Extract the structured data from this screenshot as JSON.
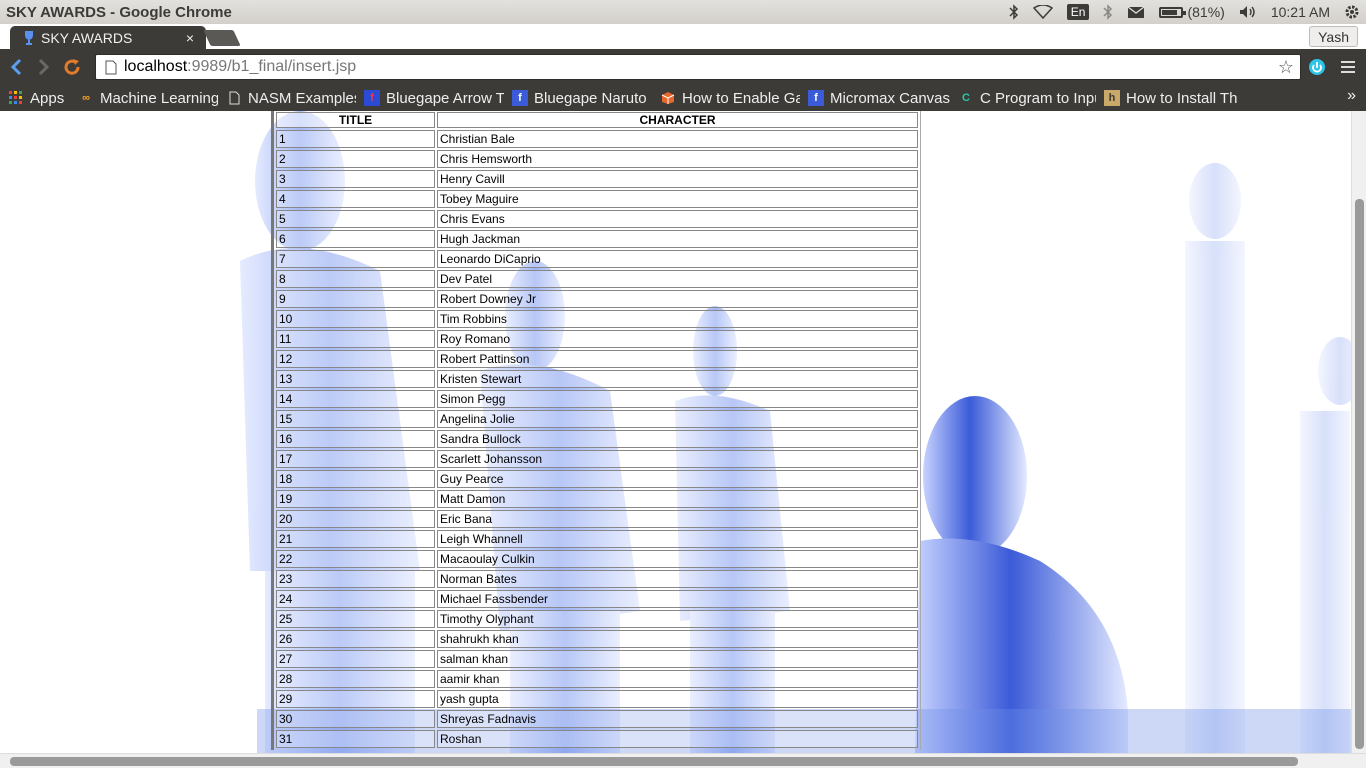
{
  "os": {
    "window_title": "SKY AWARDS - Google Chrome",
    "battery": "(81%)",
    "time": "10:21 AM",
    "input_lang": "En"
  },
  "browser": {
    "tab_title": "SKY AWARDS",
    "profile": "Yash",
    "url_host": "localhost",
    "url_rest": ":9989/b1_final/insert.jsp",
    "bookmarks": [
      {
        "label": "Apps",
        "icon": "apps-grid-icon"
      },
      {
        "label": "Machine Learning",
        "icon": "coursera-icon"
      },
      {
        "label": "NASM Examples",
        "icon": "page-icon"
      },
      {
        "label": "Bluegape Arrow T",
        "icon": "bluegape-icon"
      },
      {
        "label": "Bluegape Naruto",
        "icon": "facebook-icon"
      },
      {
        "label": "How to Enable Ga",
        "icon": "box-icon"
      },
      {
        "label": "Micromax Canvas",
        "icon": "facebook-icon"
      },
      {
        "label": "C Program to Inpu",
        "icon": "c-icon"
      },
      {
        "label": "How to Install Th",
        "icon": "h-icon"
      }
    ]
  },
  "colors": {
    "chrome_dark": "#3c3b37",
    "accent_blue": "#4d8de6",
    "statue_blue": "#3b5bd8"
  },
  "table": {
    "headers": {
      "title": "TITLE",
      "character": "CHARACTER"
    },
    "rows": [
      {
        "title": "1",
        "character": "Christian Bale"
      },
      {
        "title": "2",
        "character": "Chris Hemsworth"
      },
      {
        "title": "3",
        "character": "Henry Cavill"
      },
      {
        "title": "4",
        "character": "Tobey Maguire"
      },
      {
        "title": "5",
        "character": "Chris Evans"
      },
      {
        "title": "6",
        "character": "Hugh Jackman"
      },
      {
        "title": "7",
        "character": "Leonardo DiCaprio"
      },
      {
        "title": "8",
        "character": "Dev Patel"
      },
      {
        "title": "9",
        "character": "Robert Downey Jr"
      },
      {
        "title": "10",
        "character": "Tim Robbins"
      },
      {
        "title": "11",
        "character": "Roy Romano"
      },
      {
        "title": "12",
        "character": "Robert Pattinson"
      },
      {
        "title": "13",
        "character": "Kristen Stewart"
      },
      {
        "title": "14",
        "character": "Simon Pegg"
      },
      {
        "title": "15",
        "character": "Angelina Jolie"
      },
      {
        "title": "16",
        "character": "Sandra Bullock"
      },
      {
        "title": "17",
        "character": "Scarlett Johansson"
      },
      {
        "title": "18",
        "character": "Guy Pearce"
      },
      {
        "title": "19",
        "character": "Matt Damon"
      },
      {
        "title": "20",
        "character": "Eric Bana"
      },
      {
        "title": "21",
        "character": "Leigh Whannell"
      },
      {
        "title": "22",
        "character": "Macaoulay Culkin"
      },
      {
        "title": "23",
        "character": "Norman Bates"
      },
      {
        "title": "24",
        "character": "Michael Fassbender"
      },
      {
        "title": "25",
        "character": "Timothy Olyphant"
      },
      {
        "title": "26",
        "character": "shahrukh khan"
      },
      {
        "title": "27",
        "character": "salman khan"
      },
      {
        "title": "28",
        "character": "aamir khan"
      },
      {
        "title": "29",
        "character": "yash gupta"
      },
      {
        "title": "30",
        "character": "Shreyas Fadnavis"
      },
      {
        "title": "31",
        "character": "Roshan"
      }
    ]
  }
}
